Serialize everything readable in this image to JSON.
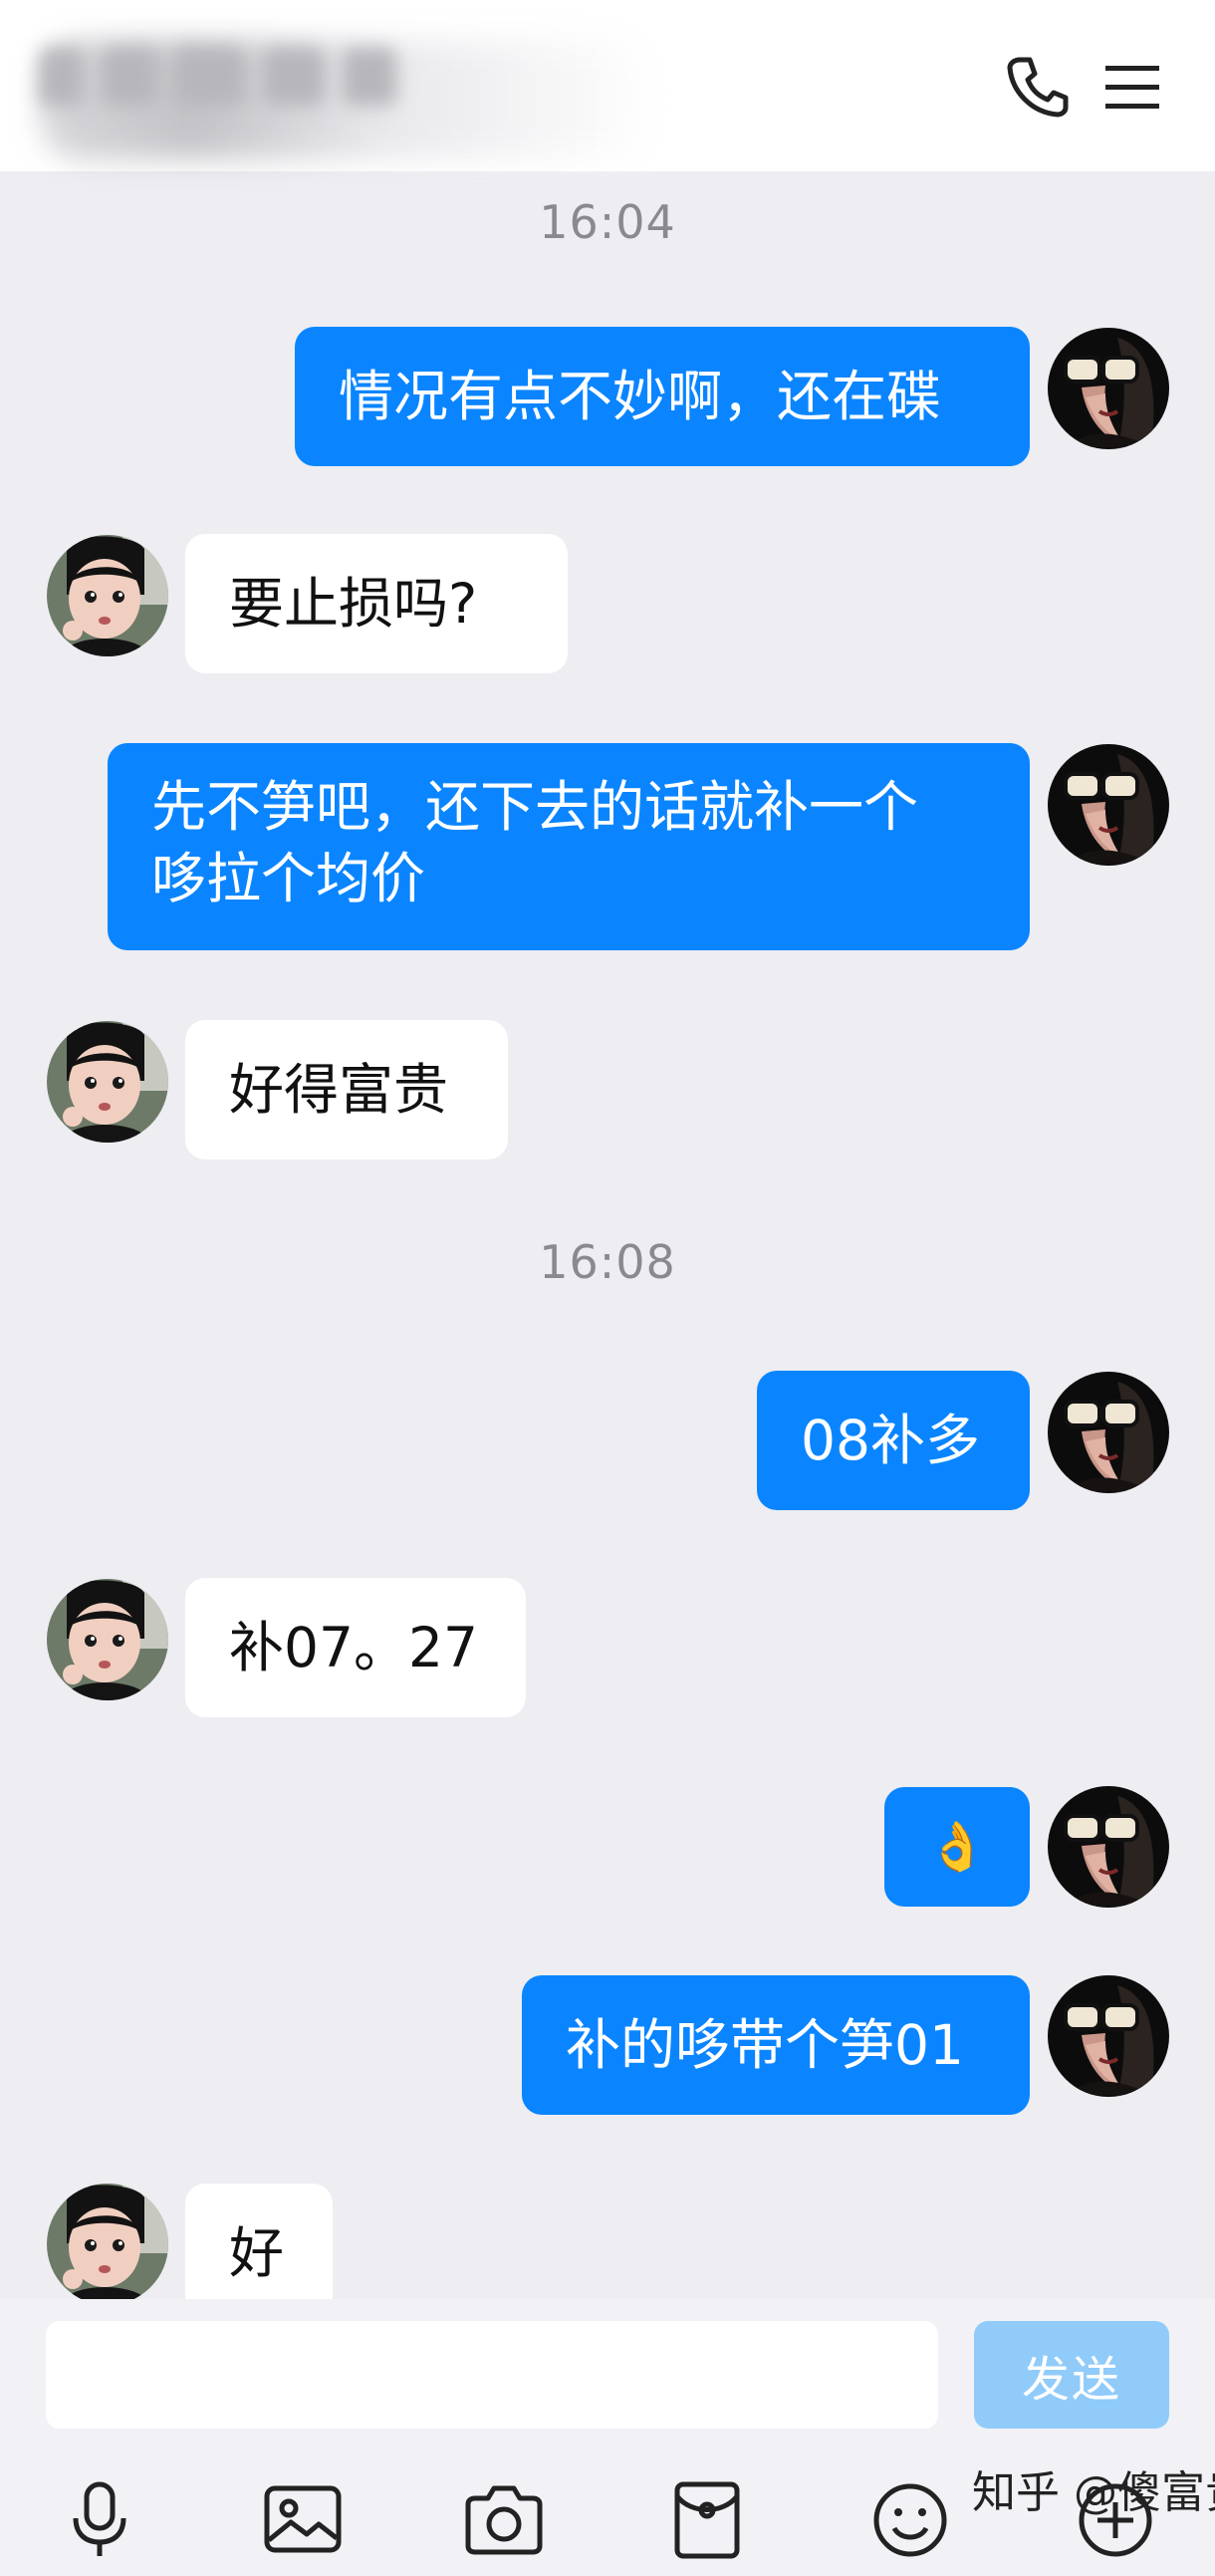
{
  "header": {
    "call_icon": "phone-icon",
    "menu_icon": "hamburger-menu-icon"
  },
  "messages_area": {
    "time_1": "16:04",
    "time_2": "16:08",
    "messages": [
      {
        "side": "me",
        "text": "情况有点不妙啊，还在碟"
      },
      {
        "side": "them",
        "text": "要止损吗?"
      },
      {
        "side": "me",
        "line1": "先不笋吧，还下去的话就补一个",
        "line2": "哆拉个均价"
      },
      {
        "side": "them",
        "text": "好得富贵"
      },
      {
        "side": "me",
        "text": "08补多"
      },
      {
        "side": "them",
        "text": "补07。27"
      },
      {
        "side": "me",
        "text": "👌"
      },
      {
        "side": "me",
        "text": "补的哆带个笋01"
      },
      {
        "side": "them",
        "text": "好"
      }
    ]
  },
  "composer": {
    "input_value": "",
    "send_label": "发送",
    "tools": [
      "microphone-icon",
      "image-icon",
      "camera-icon",
      "red-packet-icon",
      "emoji-icon",
      "plus-icon"
    ]
  },
  "watermark": "知乎 @傻富贵j",
  "colors": {
    "sent_bubble": "#0a85ff",
    "received_bubble": "#ffffff",
    "background": "#ededf2",
    "send_button": "#90cbfa"
  }
}
